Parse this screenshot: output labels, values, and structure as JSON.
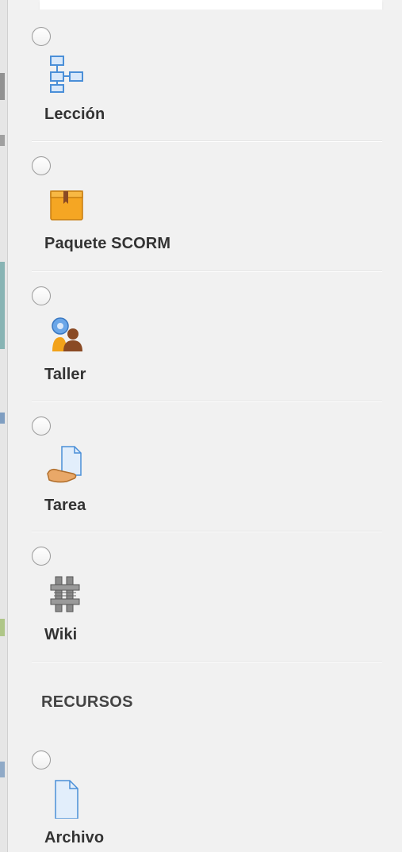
{
  "activities": [
    {
      "label": "Lección",
      "icon": "lesson-icon"
    },
    {
      "label": "Paquete SCORM",
      "icon": "scorm-package-icon"
    },
    {
      "label": "Taller",
      "icon": "workshop-icon"
    },
    {
      "label": "Tarea",
      "icon": "assignment-icon"
    },
    {
      "label": "Wiki",
      "icon": "wiki-icon"
    }
  ],
  "resources_heading": "RECURSOS",
  "resources": [
    {
      "label": "Archivo",
      "icon": "file-icon"
    }
  ],
  "colors": {
    "panel_bg": "#f1f1f1",
    "label_text": "#333333",
    "icon_blue": "#4a8fd8",
    "icon_orange": "#f2a21a",
    "icon_brown": "#8a4a24"
  }
}
